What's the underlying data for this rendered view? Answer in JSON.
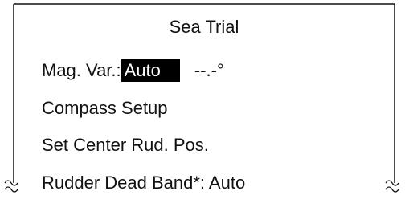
{
  "menu": {
    "title": "Sea Trial",
    "mag_var": {
      "label": "Mag. Var.:",
      "mode_value": "Auto",
      "reading": "--.-°"
    },
    "compass_setup": "Compass Setup",
    "set_center_rudder": "Set Center Rud. Pos.",
    "rudder_dead_band": "Rudder Dead Band*: Auto"
  },
  "colors": {
    "highlight_bg": "#000000",
    "highlight_fg": "#ffffff",
    "text": "#111111"
  },
  "icons": {
    "break_marks": "wavy-break-mark"
  }
}
